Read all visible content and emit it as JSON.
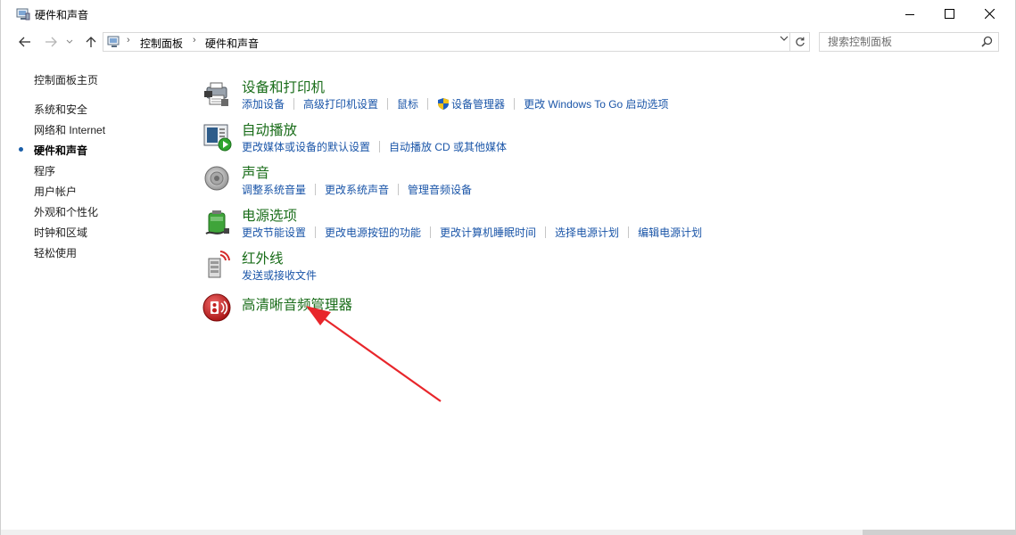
{
  "window": {
    "title": "硬件和声音"
  },
  "address": {
    "crumbs": [
      "控制面板",
      "硬件和声音"
    ]
  },
  "search": {
    "placeholder": "搜索控制面板"
  },
  "sidebar": {
    "items": [
      {
        "label": "控制面板主页"
      },
      {
        "label": "系统和安全"
      },
      {
        "label": "网络和 Internet"
      },
      {
        "label": "硬件和声音",
        "active": true
      },
      {
        "label": "程序"
      },
      {
        "label": "用户帐户"
      },
      {
        "label": "外观和个性化"
      },
      {
        "label": "时钟和区域"
      },
      {
        "label": "轻松使用"
      }
    ]
  },
  "categories": [
    {
      "title": "设备和打印机",
      "icon": "printer-icon",
      "links": [
        "添加设备",
        "高级打印机设置",
        "鼠标",
        "设备管理器",
        "更改 Windows To Go 启动选项"
      ]
    },
    {
      "title": "自动播放",
      "icon": "autoplay-icon",
      "links": [
        "更改媒体或设备的默认设置",
        "自动播放 CD 或其他媒体"
      ]
    },
    {
      "title": "声音",
      "icon": "speaker-icon",
      "links": [
        "调整系统音量",
        "更改系统声音",
        "管理音频设备"
      ]
    },
    {
      "title": "电源选项",
      "icon": "battery-icon",
      "links": [
        "更改节能设置",
        "更改电源按钮的功能",
        "更改计算机睡眠时间",
        "选择电源计划",
        "编辑电源计划"
      ]
    },
    {
      "title": "红外线",
      "icon": "infrared-icon",
      "links": [
        "发送或接收文件"
      ]
    },
    {
      "title": "高清晰音频管理器",
      "icon": "realtek-audio-icon",
      "links": []
    }
  ],
  "colors": {
    "category_title": "#1a6d1a",
    "link": "#1a55a8",
    "annotation_arrow": "#e8262b"
  }
}
